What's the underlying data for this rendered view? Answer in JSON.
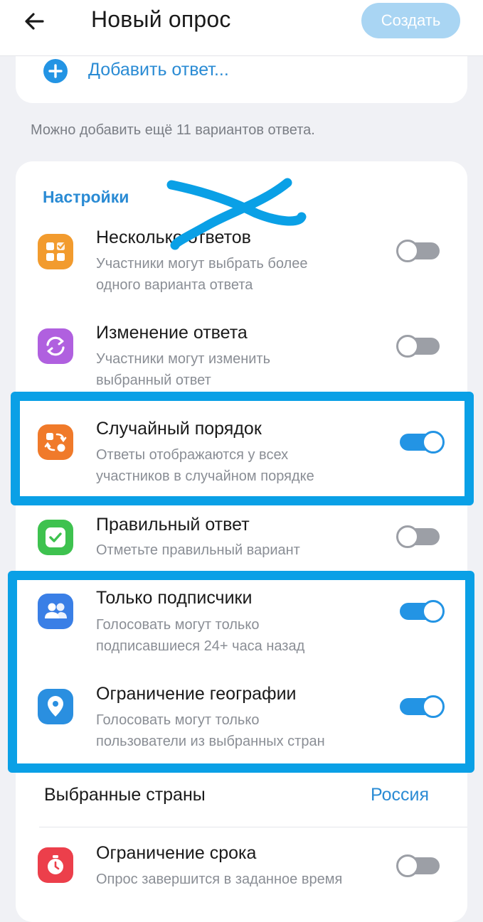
{
  "header": {
    "back_icon": "arrow-left-icon",
    "title": "Новый опрос",
    "create_label": "Создать"
  },
  "answers": {
    "add_icon": "plus-circle-icon",
    "add_label": "Добавить ответ...",
    "hint": "Можно добавить ещё 11 вариантов ответа."
  },
  "settings": {
    "title": "Настройки",
    "items": [
      {
        "icon": "multiple-answers-icon",
        "icon_color": "#f29b2e",
        "title": "Несколько ответов",
        "subtitle_1": "Участники могут выбрать более",
        "subtitle_2": "одного варианта ответа",
        "enabled": false
      },
      {
        "icon": "change-answer-icon",
        "icon_color": "#b060df",
        "title": "Изменение ответа",
        "subtitle_1": "Участники могут изменить",
        "subtitle_2": "выбранный ответ",
        "enabled": false
      },
      {
        "icon": "shuffle-icon",
        "icon_color": "#f07a2a",
        "title": "Случайный порядок",
        "subtitle_1": "Ответы отображаются у всех",
        "subtitle_2": "участников в случайном порядке",
        "enabled": true
      },
      {
        "icon": "checkmark-icon",
        "icon_color": "#3ec24f",
        "title": "Правильный ответ",
        "subtitle_1": "Отметьте правильный вариант",
        "enabled": false
      },
      {
        "icon": "subscribers-icon",
        "icon_color": "#3a7fe6",
        "title": "Только подписчики",
        "subtitle_1": "Голосовать могут только",
        "subtitle_2": "подписавшиеся 24+ часа назад",
        "enabled": true
      },
      {
        "icon": "location-pin-icon",
        "icon_color": "#2a8fe0",
        "title": "Ограничение географии",
        "subtitle_1": "Голосовать могут только",
        "subtitle_2": "пользователи из выбранных стран",
        "enabled": true
      },
      {
        "icon": "timer-icon",
        "icon_color": "#ec3f4b",
        "title": "Ограничение срока",
        "subtitle_1": "Опрос завершится в заданное время",
        "enabled": false
      }
    ],
    "countries_label": "Выбранные страны",
    "countries_value": "Россия"
  },
  "colors": {
    "accent": "#2394e4",
    "highlight_annotation": "#0aa0e6",
    "disabled_button": "#a9d5f3"
  }
}
